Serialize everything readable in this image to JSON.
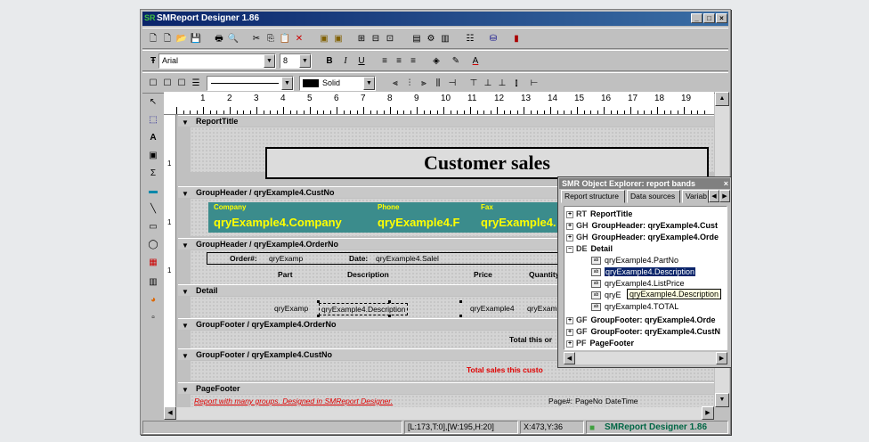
{
  "window": {
    "title": "SMReport Designer 1.86",
    "logo_text": "SR",
    "min": "_",
    "max": "□",
    "close": "×"
  },
  "toolbar3": {
    "line_style": "Solid"
  },
  "font_bar": {
    "font_name": "Arial",
    "font_size": "8",
    "bold": "B",
    "italic": "I",
    "underline": "U"
  },
  "ruler": {
    "numbers": [
      "1",
      "2",
      "3",
      "4",
      "5",
      "6",
      "7",
      "8",
      "9",
      "10",
      "11",
      "12",
      "13",
      "14",
      "15",
      "16",
      "17",
      "18",
      "19"
    ]
  },
  "vruler": {
    "numbers": [
      "1",
      "1",
      "1"
    ]
  },
  "bands": {
    "report_title": "ReportTitle",
    "group_header_cust": "GroupHeader / qryExample4.CustNo",
    "group_header_order": "GroupHeader / qryExample4.OrderNo",
    "detail": "Detail",
    "group_footer_order": "GroupFooter / qryExample4.OrderNo",
    "group_footer_cust": "GroupFooter / qryExample4.CustNo",
    "page_footer": "PageFooter"
  },
  "fields": {
    "title_text": "Customer sales",
    "company_label": "Company",
    "phone_label": "Phone",
    "fax_label": "Fax",
    "company_value": "qryExample4.Company",
    "phone_value": "qryExample4.F",
    "fax_value": "qryExample4.",
    "order_label": "Order#:",
    "order_value": "qryExamp",
    "date_label": "Date:",
    "date_value": "qryExample4.Salel",
    "col_part": "Part",
    "col_description": "Description",
    "col_price": "Price",
    "col_quantity": "Quantity",
    "detail_part": "qryExamp",
    "detail_desc": "qryExample4.Description",
    "detail_price": "qryExample4",
    "detail_qty": "qryExam",
    "total_order": "Total this or",
    "total_cust": "Total sales this custo",
    "footer_note": "Report with many groups. Designed in SMReport Designer.",
    "page_label": "Page#:",
    "page_value": "PageNo",
    "datetime": "DateTime"
  },
  "status": {
    "bounds": "[L:173,T:0],[W:195,H:20]",
    "coords": "X:473,Y:36",
    "app": "SMReport Designer 1.86"
  },
  "explorer": {
    "title": "SMR Object Explorer: report bands",
    "tabs": [
      "Report structure",
      "Data sources",
      "Variab"
    ],
    "nodes": [
      {
        "code": "RT",
        "label": "ReportTitle"
      },
      {
        "code": "GH",
        "label": "GroupHeader: qryExample4.Cust"
      },
      {
        "code": "GH",
        "label": "GroupHeader: qryExample4.Orde"
      },
      {
        "code": "DE",
        "label": "Detail"
      }
    ],
    "detail_children": [
      "qryExample4.PartNo",
      "qryExample4.Description",
      "qryExample4.ListPrice",
      "qryE",
      "qryExample4.TOTAL"
    ],
    "tooltip": "qryExample4.Description",
    "footer_nodes": [
      {
        "code": "GF",
        "label": "GroupFooter: qryExample4.Orde"
      },
      {
        "code": "GF",
        "label": "GroupFooter: qryExample4.CustN"
      },
      {
        "code": "PF",
        "label": "PageFooter"
      }
    ]
  }
}
